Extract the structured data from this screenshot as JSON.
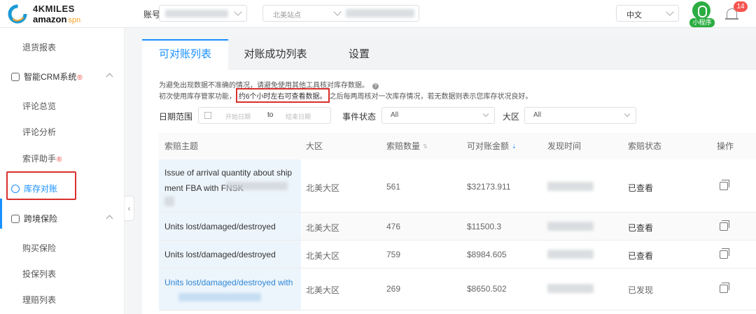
{
  "header": {
    "logo_top": "4KMILES",
    "logo_bottom": "amazon",
    "logo_suffix": "spn",
    "account_label": "账号",
    "marketplace_placeholder": "北美站点",
    "language": "中文",
    "mini_program_label": "小程序",
    "notification_count": "14"
  },
  "sidebar": {
    "items": [
      {
        "label": "退货报表",
        "type": "sub"
      },
      {
        "label": "智能CRM系统",
        "type": "group",
        "fire": "®"
      },
      {
        "label": "评论总览",
        "type": "sub"
      },
      {
        "label": "评论分析",
        "type": "sub"
      },
      {
        "label": "索评助手",
        "type": "sub",
        "fire": "®"
      },
      {
        "label": "库存对账",
        "type": "active"
      },
      {
        "label": "跨境保险",
        "type": "group"
      },
      {
        "label": "购买保险",
        "type": "sub"
      },
      {
        "label": "投保列表",
        "type": "sub"
      },
      {
        "label": "理赔列表",
        "type": "sub"
      }
    ],
    "collapse_glyph": "‹"
  },
  "tabs": [
    {
      "label": "可对账列表",
      "active": true
    },
    {
      "label": "对账成功列表",
      "active": false
    },
    {
      "label": "设置",
      "active": false
    }
  ],
  "notice": {
    "line1": "为避免出现数据不准确的情况，请避免使用其他工具核对库存数据。",
    "line2_pre": "初次使用库存管家功能，",
    "line2_highlight": "约6个小时左右可查看数据。",
    "line2_post": "之后每两周核对一次库存情况，若无数据则表示您库存状况良好。",
    "help": "?"
  },
  "filters": {
    "date_label": "日期范围",
    "start_placeholder": "开始日期",
    "to": "to",
    "end_placeholder": "结束日期",
    "event_label": "事件状态",
    "event_value": "All",
    "region_label": "大区",
    "region_value": "All"
  },
  "table": {
    "columns": [
      "索赔主题",
      "大区",
      "索赔数量",
      "可对账金额",
      "发现时间",
      "索赔状态",
      "操作"
    ],
    "sort_glyph": "⇅",
    "sort_active_glyph": "⇣",
    "rows": [
      {
        "subject": "Issue of arrival quantity about shipment FBA with FNSK",
        "region": "北美大区",
        "qty": "561",
        "amount": "$32173.911",
        "status": "已查看",
        "link": false
      },
      {
        "subject": "Units lost/damaged/destroyed",
        "region": "北美大区",
        "qty": "476",
        "amount": "$11500.3",
        "status": "已查看",
        "link": false
      },
      {
        "subject": "Units lost/damaged/destroyed",
        "region": "北美大区",
        "qty": "759",
        "amount": "$8984.605",
        "status": "已查看",
        "link": false
      },
      {
        "subject": "Units lost/damaged/destroyed with",
        "region": "北美大区",
        "qty": "269",
        "amount": "$8650.502",
        "status": "已发现",
        "link": true
      }
    ]
  }
}
